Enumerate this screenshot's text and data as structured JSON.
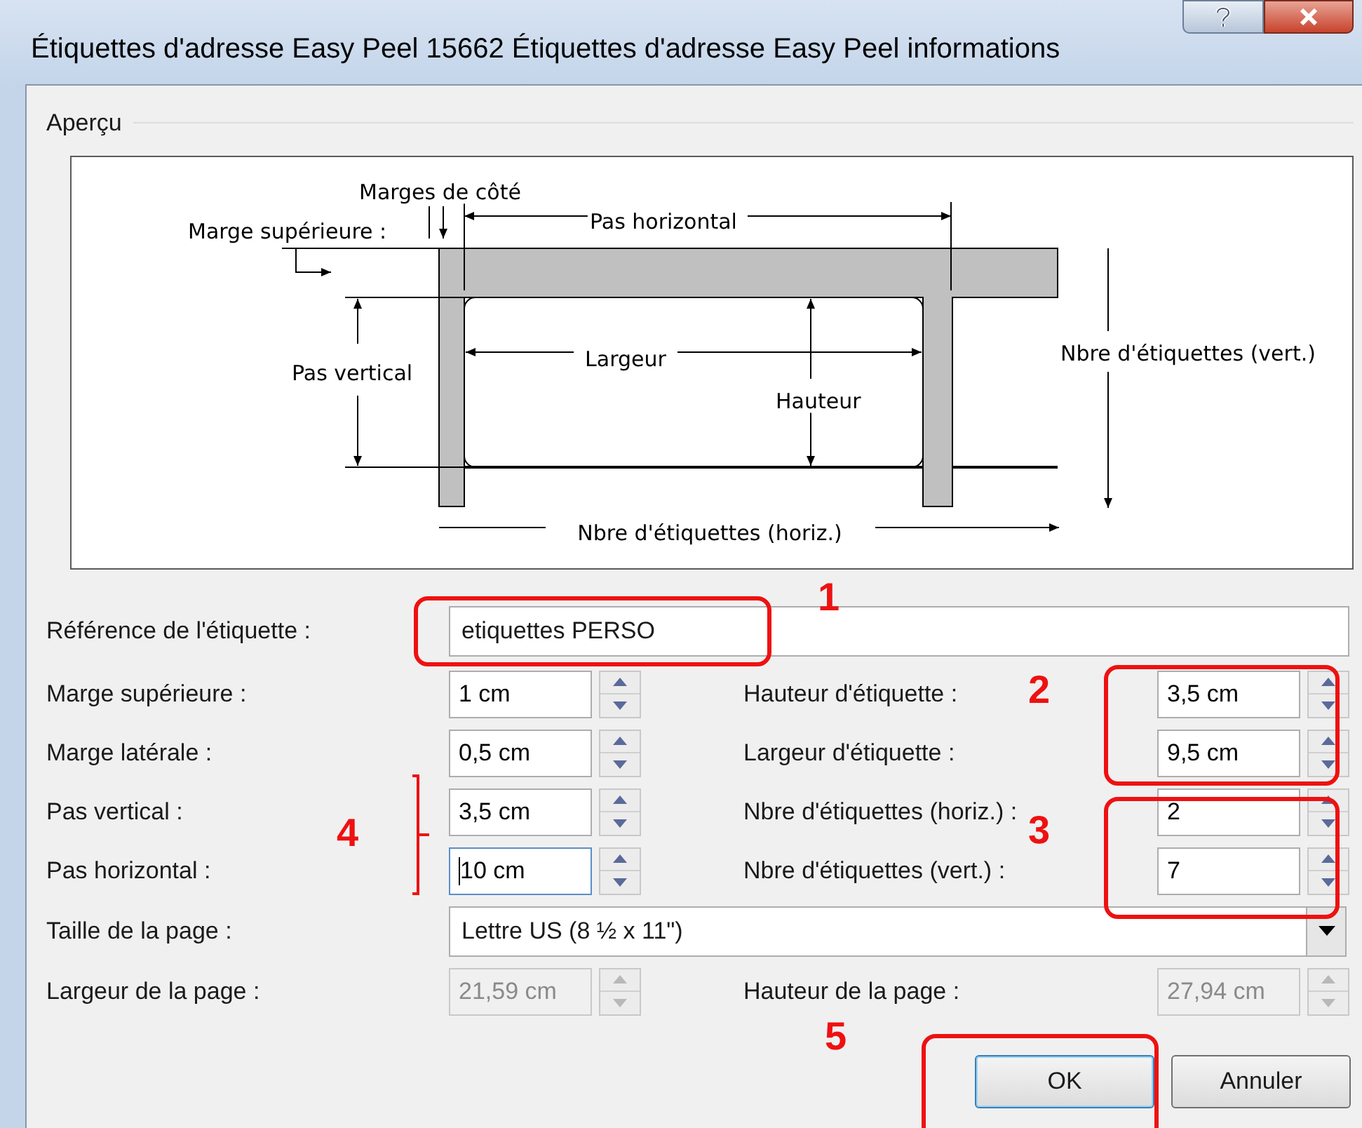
{
  "window": {
    "title": "Étiquettes d'adresse Easy Peel 15662 Étiquettes d'adresse Easy Peel informations"
  },
  "preview": {
    "group_label": "Aperçu",
    "diagram_labels": [
      "Marges de côté",
      "Marge supérieure :",
      "Pas horizontal",
      "Pas vertical",
      "Largeur",
      "Hauteur",
      "Nbre d'étiquettes (vert.)",
      "Nbre d'étiquettes (horiz.)"
    ]
  },
  "reference": {
    "label": "Référence de l'étiquette :",
    "value": "etiquettes PERSO"
  },
  "spin_rows": [
    {
      "left": {
        "label": "Marge supérieure :",
        "value": "1 cm",
        "focused": false,
        "disabled": false
      },
      "right": {
        "label": "Hauteur d'étiquette :",
        "value": "3,5 cm",
        "focused": false,
        "disabled": false
      }
    },
    {
      "left": {
        "label": "Marge latérale :",
        "value": "0,5 cm",
        "focused": false,
        "disabled": false
      },
      "right": {
        "label": "Largeur d'étiquette :",
        "value": "9,5 cm",
        "focused": false,
        "disabled": false
      }
    },
    {
      "left": {
        "label": "Pas vertical :",
        "value": "3,5 cm",
        "focused": false,
        "disabled": false
      },
      "right": {
        "label": "Nbre d'étiquettes (horiz.) :",
        "value": "2",
        "focused": false,
        "disabled": false
      }
    },
    {
      "left": {
        "label": "Pas horizontal :",
        "value": "10 cm",
        "focused": true,
        "disabled": false
      },
      "right": {
        "label": "Nbre d'étiquettes (vert.) :",
        "value": "7",
        "focused": false,
        "disabled": false
      }
    }
  ],
  "page_size": {
    "label": "Taille de la page :",
    "value": "Lettre US (8 ½ x 11\")"
  },
  "page_dims": {
    "left": {
      "label": "Largeur de la page :",
      "value": "21,59 cm",
      "focused": false,
      "disabled": true
    },
    "right": {
      "label": "Hauteur de la page :",
      "value": "27,94 cm",
      "focused": false,
      "disabled": true
    }
  },
  "buttons": [
    {
      "label": "OK",
      "default": true
    },
    {
      "label": "Annuler",
      "default": false
    }
  ],
  "annotations": [
    {
      "number": "1"
    },
    {
      "number": "2"
    },
    {
      "number": "3"
    },
    {
      "number": "4"
    },
    {
      "number": "5"
    }
  ]
}
